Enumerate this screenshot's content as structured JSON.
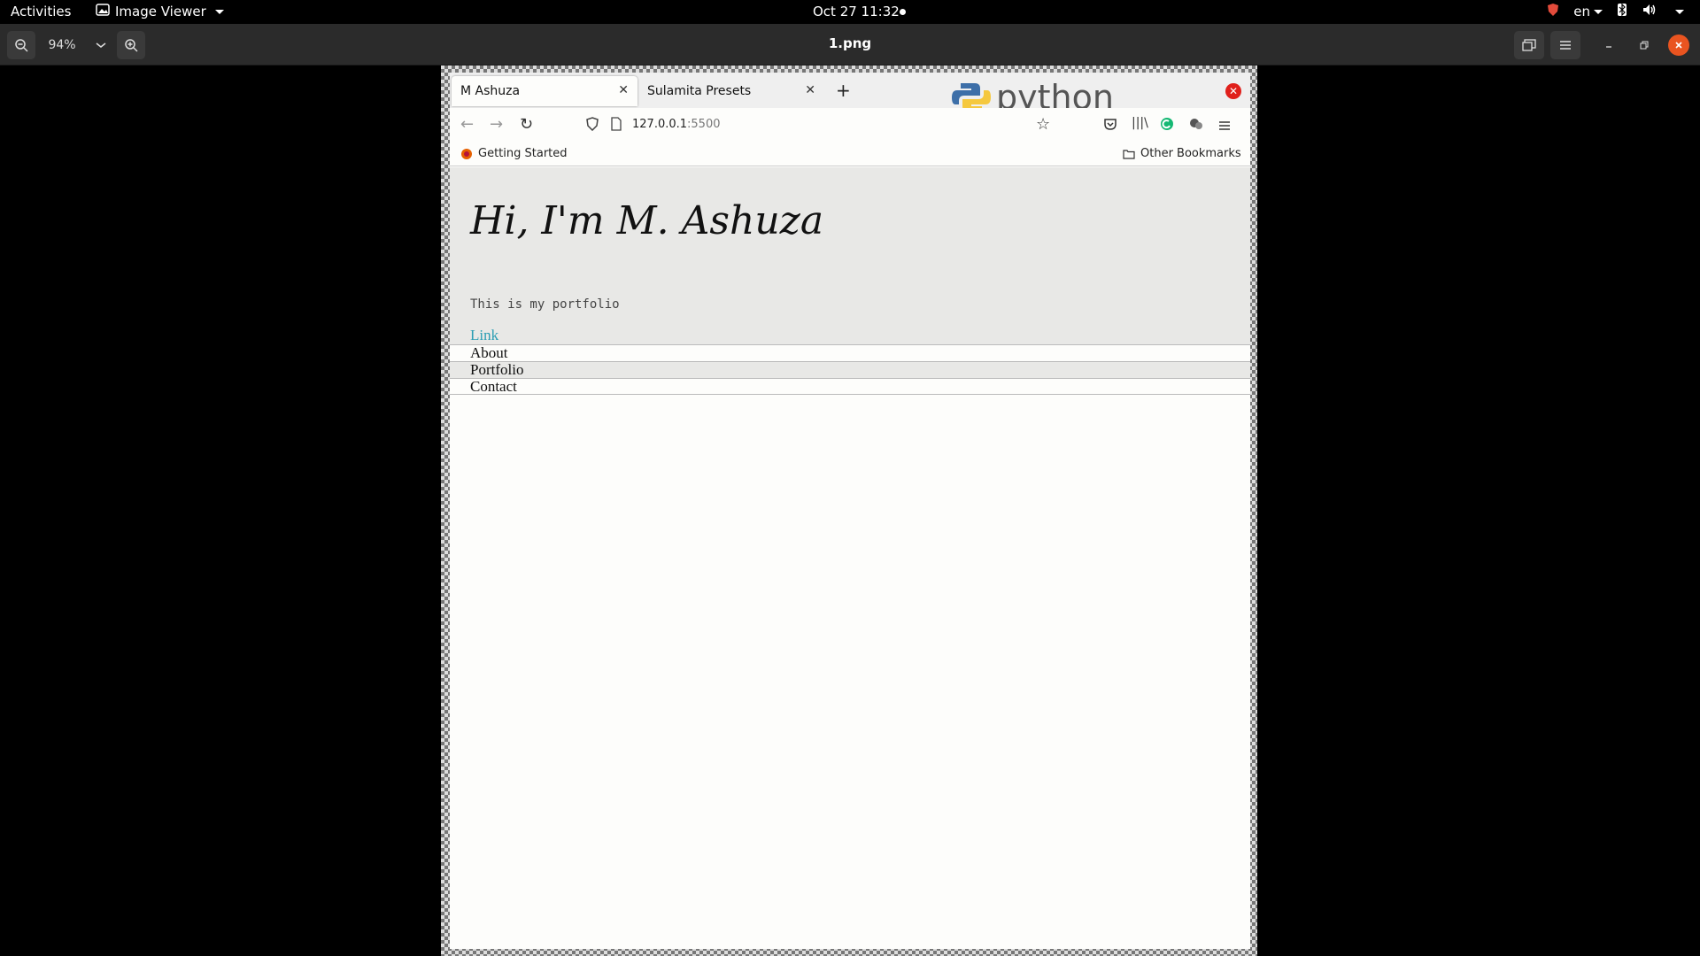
{
  "topbar": {
    "activities": "Activities",
    "app_name": "Image Viewer",
    "clock": "Oct 27  11:32",
    "lang": "en"
  },
  "viewer": {
    "zoom": "94%",
    "title": "1.png"
  },
  "browser": {
    "tabs": [
      {
        "label": "M Ashuza"
      },
      {
        "label": "Sulamita Presets"
      }
    ],
    "logo_text": "python",
    "url_host": "127.0.0.1",
    "url_port": ":5500",
    "bookmarks": {
      "getting_started": "Getting Started",
      "other": "Other Bookmarks"
    }
  },
  "page": {
    "heading": "Hi, I'm M. Ashuza",
    "tagline": "This is my portfolio",
    "link": "Link",
    "nav": [
      {
        "label": "About"
      },
      {
        "label": "Portfolio"
      },
      {
        "label": "Contact"
      }
    ]
  }
}
